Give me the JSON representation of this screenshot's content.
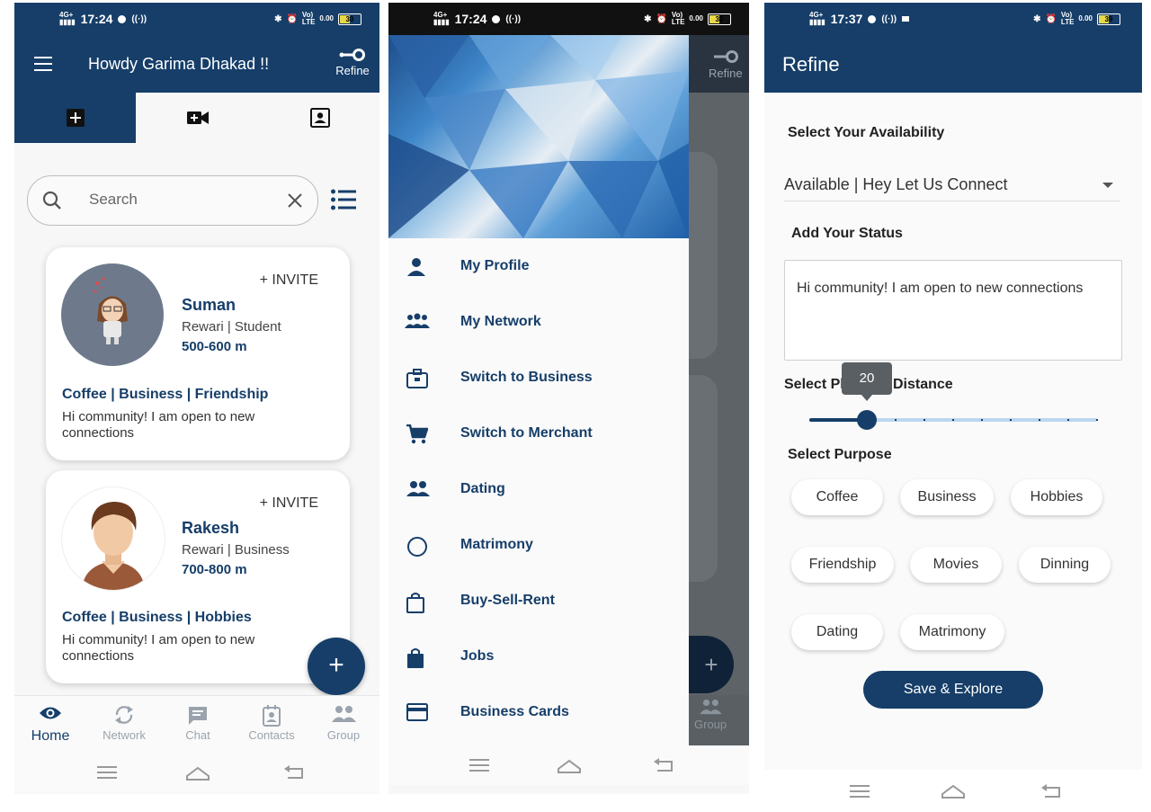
{
  "status_bar": {
    "screen1_time": "17:24",
    "screen2_time": "17:24",
    "screen3_time": "17:37",
    "net_speed": "0.00",
    "battery1": "30",
    "battery2": "30",
    "battery3": "39"
  },
  "home": {
    "title": "Howdy Garima Dhakad !!",
    "refine_label": "Refine",
    "search_placeholder": "Search",
    "cards": [
      {
        "invite": "+ INVITE",
        "name": "Suman",
        "meta": "Rewari | Student",
        "distance": "500-600 m",
        "tags": "Coffee | Business | Friendship",
        "status": "Hi community! I am open to new connections"
      },
      {
        "invite": "+ INVITE",
        "name": "Rakesh",
        "meta": "Rewari | Business",
        "distance": "700-800 m",
        "tags": "Coffee | Business | Hobbies",
        "status": "Hi community! I am open to new connections"
      }
    ],
    "fab": "+",
    "bottom_nav": [
      {
        "label": "Home",
        "icon": "eye-icon"
      },
      {
        "label": "Network",
        "icon": "sync-icon"
      },
      {
        "label": "Chat",
        "icon": "chat-icon"
      },
      {
        "label": "Contacts",
        "icon": "contacts-icon"
      },
      {
        "label": "Group",
        "icon": "group-icon"
      }
    ]
  },
  "drawer": {
    "refine_label": "Refine",
    "group_label": "Group",
    "items": [
      {
        "label": "My Profile",
        "icon": "person-icon"
      },
      {
        "label": "My Network",
        "icon": "network-icon"
      },
      {
        "label": "Switch to Business",
        "icon": "briefcase-icon"
      },
      {
        "label": "Switch to Merchant",
        "icon": "cart-icon"
      },
      {
        "label": "Dating",
        "icon": "people-icon"
      },
      {
        "label": "Matrimony",
        "icon": "ring-icon"
      },
      {
        "label": "Buy-Sell-Rent",
        "icon": "shopping-bag-icon"
      },
      {
        "label": "Jobs",
        "icon": "jobs-bag-icon"
      },
      {
        "label": "Business Cards",
        "icon": "card-icon"
      }
    ]
  },
  "refine": {
    "title": "Refine",
    "availability_label": "Select Your Availability",
    "availability_value": "Available | Hey Let Us Connect",
    "status_label": "Add Your Status",
    "status_value": "Hi community! I am open to new connections",
    "distance_label": "Select Physical Distance",
    "distance_value": "20",
    "distance_fraction": 0.2,
    "purpose_label": "Select Purpose",
    "purposes": [
      "Coffee",
      "Business",
      "Hobbies",
      "Friendship",
      "Movies",
      "Dinning",
      "Dating",
      "Matrimony"
    ],
    "save_label": "Save & Explore"
  },
  "colors": {
    "primary": "#163e69",
    "inactive_nav": "#9aa3ad",
    "scrim": "#5e6367"
  }
}
